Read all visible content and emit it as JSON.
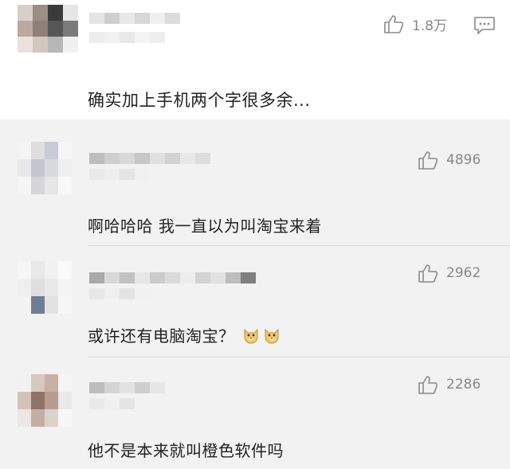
{
  "main_comment": {
    "likes": "1.8万",
    "text": "确实加上手机两个字很多余..."
  },
  "replies": [
    {
      "likes": "4896",
      "text": "啊哈哈哈 我一直以为叫淘宝来着"
    },
    {
      "likes": "2962",
      "text": "或许还有电脑淘宝？"
    },
    {
      "likes": "2286",
      "text": "他不是本来就叫橙色软件吗"
    }
  ],
  "icons": {
    "like": "thumbs-up-icon",
    "reply": "comment-bubble-icon",
    "emoji": "doge-emoji-icon"
  },
  "colors": {
    "text": "#222222",
    "meta": "#888888",
    "background_top": "#ffffff",
    "background_replies": "#f2f2f2"
  }
}
